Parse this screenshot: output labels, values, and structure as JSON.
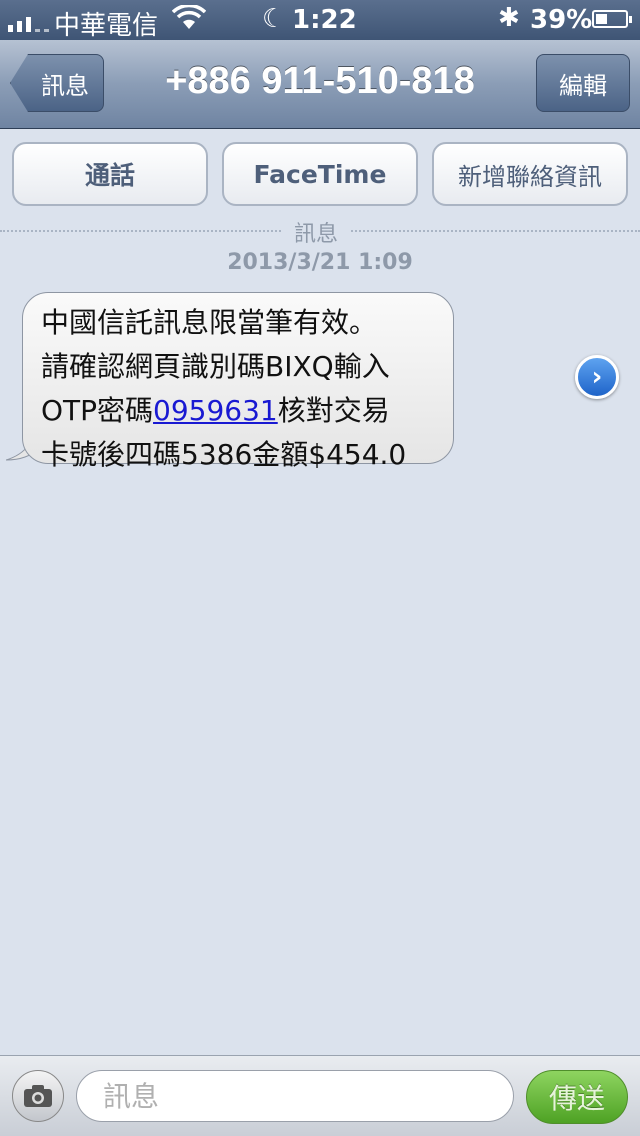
{
  "status_bar": {
    "carrier": "中華電信",
    "time": "1:22",
    "battery_percent": "39%",
    "battery_level": 0.39,
    "icons": [
      "signal-icon",
      "wifi-icon",
      "moon-icon",
      "bluetooth-icon",
      "battery-icon"
    ]
  },
  "nav": {
    "back_label": "訊息",
    "title": "+886 911-510-818",
    "edit_label": "編輯"
  },
  "actions": {
    "call_label": "通話",
    "facetime_label": "FaceTime",
    "add_contact_label": "新增聯絡資訊"
  },
  "conversation": {
    "divider_label": "訊息",
    "timestamp": "2013/3/21 1:09",
    "message": {
      "line1": "中國信託訊息限當筆有效。",
      "line2": "請確認網頁識別碼BIXQ輸入",
      "line3_prefix": "OTP密碼",
      "line3_link": "0959631",
      "line3_suffix": "核對交易",
      "line4": "卡號後四碼5386金額$454.0"
    }
  },
  "input_bar": {
    "placeholder": "訊息",
    "send_label": "傳送"
  },
  "colors": {
    "background": "#dbe2ed",
    "nav_gradient_top": "#b6c2d3",
    "send_green": "#4ea224",
    "link_blue": "#1919d2"
  }
}
